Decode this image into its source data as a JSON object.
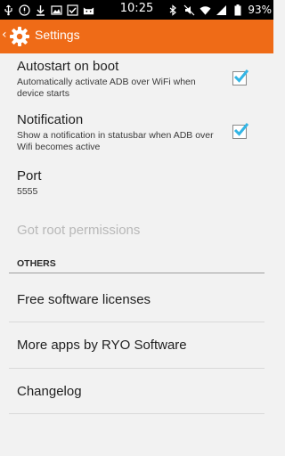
{
  "status_bar": {
    "time": "10:25",
    "battery_text": "93%"
  },
  "action_bar": {
    "title": "Settings"
  },
  "preferences": {
    "autostart": {
      "title": "Autostart on boot",
      "summary": "Automatically activate ADB over WiFi when device starts",
      "checked": true
    },
    "notification": {
      "title": "Notification",
      "summary": "Show a notification in statusbar when ADB over Wifi becomes active",
      "checked": true
    },
    "port": {
      "title": "Port",
      "value": "5555"
    },
    "root": {
      "title": "Got root permissions"
    }
  },
  "others": {
    "header": "OTHERS",
    "items": [
      {
        "label": "Free software licenses"
      },
      {
        "label": "More apps by RYO Software"
      },
      {
        "label": "Changelog"
      }
    ]
  },
  "colors": {
    "accent": "#ef6b17",
    "checkmark": "#33b5e5"
  }
}
